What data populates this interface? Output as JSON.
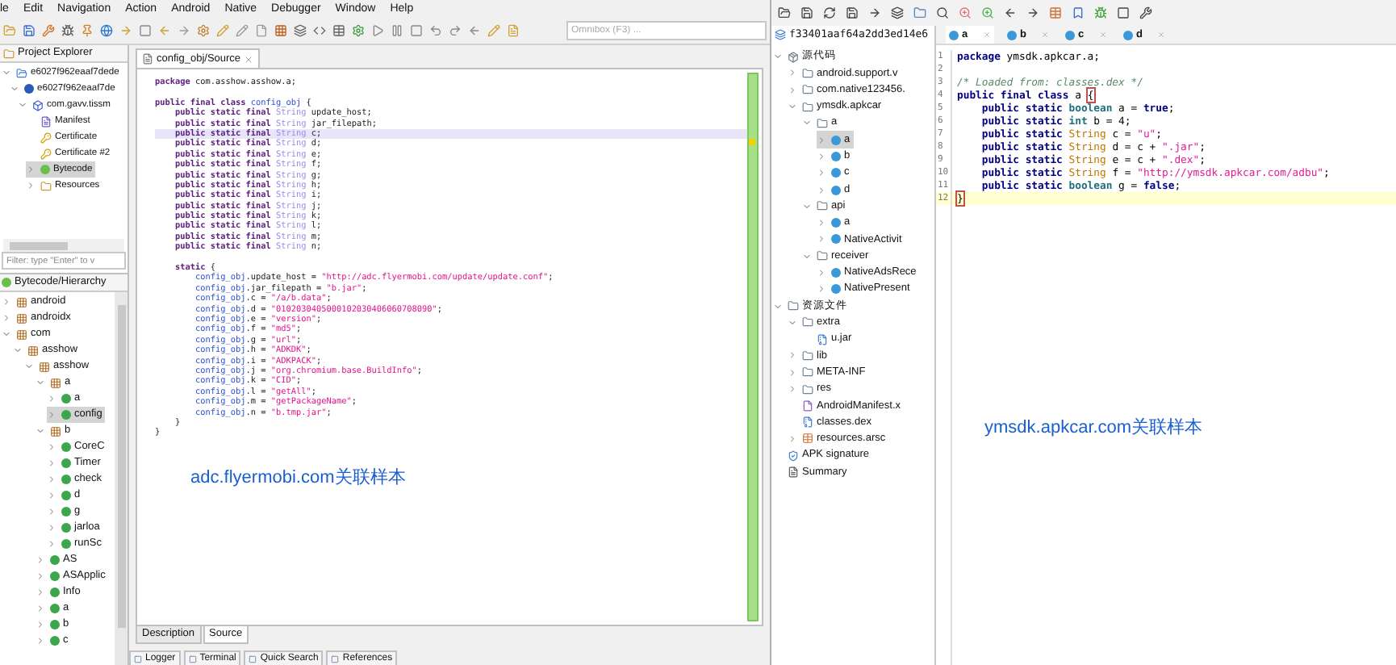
{
  "jeb_window": {
    "menu": [
      "le",
      "Edit",
      "Navigation",
      "Action",
      "Android",
      "Native",
      "Debugger",
      "Window",
      "Help"
    ],
    "omnibox": {
      "placeholder": "Omnibox (F3) ..."
    },
    "project_explorer": {
      "title": "Project Explorer",
      "tree": [
        {
          "label": "e6027f962eaaf7dede",
          "kind": "project",
          "expanded": true,
          "selected": false,
          "children": [
            {
              "label": "e6027f962eaaf7de",
              "kind": "apk",
              "expanded": true,
              "selected": false,
              "children": [
                {
                  "label": "com.gavv.tissm",
                  "kind": "app",
                  "expanded": true,
                  "selected": false,
                  "children": [
                    {
                      "label": "Manifest",
                      "kind": "manifest",
                      "selected": false
                    },
                    {
                      "label": "Certificate",
                      "kind": "cert",
                      "selected": false
                    },
                    {
                      "label": "Certificate #2",
                      "kind": "cert",
                      "selected": false
                    },
                    {
                      "label": "Bytecode",
                      "kind": "bytecode",
                      "expanded": false,
                      "selected": true
                    },
                    {
                      "label": "Resources",
                      "kind": "folder",
                      "expanded": false,
                      "selected": false
                    }
                  ]
                }
              ]
            }
          ]
        }
      ],
      "filter": {
        "placeholder": "Filter: type \"Enter\" to v"
      }
    },
    "hierarchy": {
      "title": "Bytecode/Hierarchy",
      "tree": [
        {
          "label": "android",
          "kind": "package",
          "expanded": false,
          "selected": false
        },
        {
          "label": "androidx",
          "kind": "package",
          "expanded": false,
          "selected": false
        },
        {
          "label": "com",
          "kind": "package",
          "expanded": true,
          "selected": false,
          "children": [
            {
              "label": "asshow",
              "kind": "package",
              "expanded": true,
              "selected": false,
              "children": [
                {
                  "label": "asshow",
                  "kind": "package",
                  "expanded": true,
                  "selected": false,
                  "children": [
                    {
                      "label": "a",
                      "kind": "package",
                      "expanded": true,
                      "selected": false,
                      "children": [
                        {
                          "label": "a",
                          "kind": "class",
                          "expanded": false,
                          "selected": false
                        },
                        {
                          "label": "config",
                          "kind": "class",
                          "expanded": false,
                          "selected": true
                        }
                      ]
                    },
                    {
                      "label": "b",
                      "kind": "package",
                      "expanded": true,
                      "selected": false,
                      "children": [
                        {
                          "label": "CoreC",
                          "kind": "class",
                          "expanded": false,
                          "selected": false
                        },
                        {
                          "label": "Timer",
                          "kind": "class",
                          "expanded": false,
                          "selected": false
                        },
                        {
                          "label": "check",
                          "kind": "class",
                          "expanded": false,
                          "selected": false
                        },
                        {
                          "label": "d",
                          "kind": "class",
                          "expanded": false,
                          "selected": false
                        },
                        {
                          "label": "g",
                          "kind": "class",
                          "expanded": false,
                          "selected": false
                        },
                        {
                          "label": "jarloa",
                          "kind": "class",
                          "expanded": false,
                          "selected": false
                        },
                        {
                          "label": "runSc",
                          "kind": "class",
                          "expanded": false,
                          "selected": false
                        }
                      ]
                    },
                    {
                      "label": "AS",
                      "kind": "class",
                      "expanded": false,
                      "selected": false
                    },
                    {
                      "label": "ASApplic",
                      "kind": "class",
                      "expanded": false,
                      "selected": false
                    },
                    {
                      "label": "Info",
                      "kind": "class",
                      "expanded": false,
                      "selected": false
                    },
                    {
                      "label": "a",
                      "kind": "class",
                      "expanded": false,
                      "selected": false
                    },
                    {
                      "label": "b",
                      "kind": "class",
                      "expanded": false,
                      "selected": false
                    },
                    {
                      "label": "c",
                      "kind": "class",
                      "expanded": false,
                      "selected": false
                    }
                  ]
                }
              ]
            }
          ]
        }
      ]
    },
    "editor": {
      "tab": "config_obj/Source",
      "blocks": [
        [
          {
            "current": false,
            "tokens": [
              {
                "kind": "kw",
                "text": "package"
              },
              {
                "kind": "plain",
                "text": " com.asshow.asshow.a;"
              }
            ]
          }
        ],
        [
          {
            "current": false,
            "tokens": [
              {
                "kind": "kw",
                "text": "public final class "
              },
              {
                "kind": "cls",
                "text": "config_obj"
              },
              {
                "kind": "plain",
                "text": " {"
              }
            ]
          },
          {
            "current": false,
            "tokens": [
              {
                "kind": "kw",
                "text": "    public static final "
              },
              {
                "kind": "type",
                "text": "String"
              },
              {
                "kind": "plain",
                "text": " update_host;"
              }
            ]
          },
          {
            "current": false,
            "tokens": [
              {
                "kind": "kw",
                "text": "    public static final "
              },
              {
                "kind": "type",
                "text": "String"
              },
              {
                "kind": "plain",
                "text": " jar_filepath;"
              }
            ]
          },
          {
            "current": true,
            "tokens": [
              {
                "kind": "kw",
                "text": "    public static final "
              },
              {
                "kind": "type",
                "text": "String"
              },
              {
                "kind": "plain",
                "text": " c;"
              }
            ]
          },
          {
            "current": false,
            "tokens": [
              {
                "kind": "kw",
                "text": "    public static final "
              },
              {
                "kind": "type",
                "text": "String"
              },
              {
                "kind": "plain",
                "text": " d;"
              }
            ]
          },
          {
            "current": false,
            "tokens": [
              {
                "kind": "kw",
                "text": "    public static final "
              },
              {
                "kind": "type",
                "text": "String"
              },
              {
                "kind": "plain",
                "text": " e;"
              }
            ]
          },
          {
            "current": false,
            "tokens": [
              {
                "kind": "kw",
                "text": "    public static final "
              },
              {
                "kind": "type",
                "text": "String"
              },
              {
                "kind": "plain",
                "text": " f;"
              }
            ]
          },
          {
            "current": false,
            "tokens": [
              {
                "kind": "kw",
                "text": "    public static final "
              },
              {
                "kind": "type",
                "text": "String"
              },
              {
                "kind": "plain",
                "text": " g;"
              }
            ]
          },
          {
            "current": false,
            "tokens": [
              {
                "kind": "kw",
                "text": "    public static final "
              },
              {
                "kind": "type",
                "text": "String"
              },
              {
                "kind": "plain",
                "text": " h;"
              }
            ]
          },
          {
            "current": false,
            "tokens": [
              {
                "kind": "kw",
                "text": "    public static final "
              },
              {
                "kind": "type",
                "text": "String"
              },
              {
                "kind": "plain",
                "text": " i;"
              }
            ]
          },
          {
            "current": false,
            "tokens": [
              {
                "kind": "kw",
                "text": "    public static final "
              },
              {
                "kind": "type",
                "text": "String"
              },
              {
                "kind": "plain",
                "text": " j;"
              }
            ]
          },
          {
            "current": false,
            "tokens": [
              {
                "kind": "kw",
                "text": "    public static final "
              },
              {
                "kind": "type",
                "text": "String"
              },
              {
                "kind": "plain",
                "text": " k;"
              }
            ]
          },
          {
            "current": false,
            "tokens": [
              {
                "kind": "kw",
                "text": "    public static final "
              },
              {
                "kind": "type",
                "text": "String"
              },
              {
                "kind": "plain",
                "text": " l;"
              }
            ]
          },
          {
            "current": false,
            "tokens": [
              {
                "kind": "kw",
                "text": "    public static final "
              },
              {
                "kind": "type",
                "text": "String"
              },
              {
                "kind": "plain",
                "text": " m;"
              }
            ]
          },
          {
            "current": false,
            "tokens": [
              {
                "kind": "kw",
                "text": "    public static final "
              },
              {
                "kind": "type",
                "text": "String"
              },
              {
                "kind": "plain",
                "text": " n;"
              }
            ]
          }
        ],
        [
          {
            "current": false,
            "tokens": [
              {
                "kind": "kw",
                "text": "    static"
              },
              {
                "kind": "plain",
                "text": " {"
              }
            ]
          },
          {
            "current": false,
            "tokens": [
              {
                "kind": "cls",
                "text": "        config_obj"
              },
              {
                "kind": "plain",
                "text": ".update_host = "
              },
              {
                "kind": "str",
                "text": "\"http://adc.flyermobi.com/update/update.conf\""
              },
              {
                "kind": "plain",
                "text": ";"
              }
            ]
          },
          {
            "current": false,
            "tokens": [
              {
                "kind": "cls",
                "text": "        config_obj"
              },
              {
                "kind": "plain",
                "text": ".jar_filepath = "
              },
              {
                "kind": "str",
                "text": "\"b.jar\""
              },
              {
                "kind": "plain",
                "text": ";"
              }
            ]
          },
          {
            "current": false,
            "tokens": [
              {
                "kind": "cls",
                "text": "        config_obj"
              },
              {
                "kind": "plain",
                "text": ".c = "
              },
              {
                "kind": "str",
                "text": "\"/a/b.data\""
              },
              {
                "kind": "plain",
                "text": ";"
              }
            ]
          },
          {
            "current": false,
            "tokens": [
              {
                "kind": "cls",
                "text": "        config_obj"
              },
              {
                "kind": "plain",
                "text": ".d = "
              },
              {
                "kind": "str",
                "text": "\"0102030405000102030406060708090\""
              },
              {
                "kind": "plain",
                "text": ";"
              }
            ]
          },
          {
            "current": false,
            "tokens": [
              {
                "kind": "cls",
                "text": "        config_obj"
              },
              {
                "kind": "plain",
                "text": ".e = "
              },
              {
                "kind": "str",
                "text": "\"version\""
              },
              {
                "kind": "plain",
                "text": ";"
              }
            ]
          },
          {
            "current": false,
            "tokens": [
              {
                "kind": "cls",
                "text": "        config_obj"
              },
              {
                "kind": "plain",
                "text": ".f = "
              },
              {
                "kind": "str",
                "text": "\"md5\""
              },
              {
                "kind": "plain",
                "text": ";"
              }
            ]
          },
          {
            "current": false,
            "tokens": [
              {
                "kind": "cls",
                "text": "        config_obj"
              },
              {
                "kind": "plain",
                "text": ".g = "
              },
              {
                "kind": "str",
                "text": "\"url\""
              },
              {
                "kind": "plain",
                "text": ";"
              }
            ]
          },
          {
            "current": false,
            "tokens": [
              {
                "kind": "cls",
                "text": "        config_obj"
              },
              {
                "kind": "plain",
                "text": ".h = "
              },
              {
                "kind": "str",
                "text": "\"ADKDK\""
              },
              {
                "kind": "plain",
                "text": ";"
              }
            ]
          },
          {
            "current": false,
            "tokens": [
              {
                "kind": "cls",
                "text": "        config_obj"
              },
              {
                "kind": "plain",
                "text": ".i = "
              },
              {
                "kind": "str",
                "text": "\"ADKPACK\""
              },
              {
                "kind": "plain",
                "text": ";"
              }
            ]
          },
          {
            "current": false,
            "tokens": [
              {
                "kind": "cls",
                "text": "        config_obj"
              },
              {
                "kind": "plain",
                "text": ".j = "
              },
              {
                "kind": "str",
                "text": "\"org.chromium.base.BuildInfo\""
              },
              {
                "kind": "plain",
                "text": ";"
              }
            ]
          },
          {
            "current": false,
            "tokens": [
              {
                "kind": "cls",
                "text": "        config_obj"
              },
              {
                "kind": "plain",
                "text": ".k = "
              },
              {
                "kind": "str",
                "text": "\"CID\""
              },
              {
                "kind": "plain",
                "text": ";"
              }
            ]
          },
          {
            "current": false,
            "tokens": [
              {
                "kind": "cls",
                "text": "        config_obj"
              },
              {
                "kind": "plain",
                "text": ".l = "
              },
              {
                "kind": "str",
                "text": "\"getAll\""
              },
              {
                "kind": "plain",
                "text": ";"
              }
            ]
          },
          {
            "current": false,
            "tokens": [
              {
                "kind": "cls",
                "text": "        config_obj"
              },
              {
                "kind": "plain",
                "text": ".m = "
              },
              {
                "kind": "str",
                "text": "\"getPackageName\""
              },
              {
                "kind": "plain",
                "text": ";"
              }
            ]
          },
          {
            "current": false,
            "tokens": [
              {
                "kind": "cls",
                "text": "        config_obj"
              },
              {
                "kind": "plain",
                "text": ".n = "
              },
              {
                "kind": "str",
                "text": "\"b.tmp.jar\""
              },
              {
                "kind": "plain",
                "text": ";"
              }
            ]
          },
          {
            "current": false,
            "tokens": [
              {
                "kind": "plain",
                "text": "    }"
              }
            ]
          },
          {
            "current": false,
            "tokens": [
              {
                "kind": "plain",
                "text": "}"
              }
            ]
          }
        ]
      ],
      "view_tabs": [
        {
          "label": "Description",
          "selected": false
        },
        {
          "label": "Source",
          "selected": true
        }
      ]
    },
    "bottom_tabs": [
      "Logger",
      "Terminal",
      "Quick Search",
      "References"
    ],
    "caption": "adc.flyermobi.com关联样本"
  },
  "jadx_window": {
    "tree_root": "f33401aaf64a2dd3ed14e6",
    "tree": [
      {
        "label": "源代码",
        "kind": "sources",
        "expanded": true,
        "selected": false,
        "children": [
          {
            "label": "android.support.v",
            "kind": "package",
            "expanded": false,
            "selected": false
          },
          {
            "label": "com.native123456.",
            "kind": "package",
            "expanded": false,
            "selected": false
          },
          {
            "label": "ymsdk.apkcar",
            "kind": "package",
            "expanded": true,
            "selected": false,
            "children": [
              {
                "label": "a",
                "kind": "package",
                "expanded": true,
                "selected": false,
                "children": [
                  {
                    "label": "a",
                    "kind": "class",
                    "expanded": false,
                    "selected": true
                  },
                  {
                    "label": "b",
                    "kind": "class",
                    "expanded": false,
                    "selected": false
                  },
                  {
                    "label": "c",
                    "kind": "class",
                    "expanded": false,
                    "selected": false
                  },
                  {
                    "label": "d",
                    "kind": "class",
                    "expanded": false,
                    "selected": false
                  }
                ]
              },
              {
                "label": "api",
                "kind": "package",
                "expanded": true,
                "selected": false,
                "children": [
                  {
                    "label": "a",
                    "kind": "class",
                    "expanded": false,
                    "selected": false
                  },
                  {
                    "label": "NativeActivit",
                    "kind": "class",
                    "expanded": false,
                    "selected": false
                  }
                ]
              },
              {
                "label": "receiver",
                "kind": "package",
                "expanded": true,
                "selected": false,
                "children": [
                  {
                    "label": "NativeAdsRece",
                    "kind": "class",
                    "expanded": false,
                    "selected": false
                  },
                  {
                    "label": "NativePresent",
                    "kind": "class",
                    "expanded": false,
                    "selected": false
                  }
                ]
              }
            ]
          }
        ]
      },
      {
        "label": "资源文件",
        "kind": "resources",
        "expanded": true,
        "selected": false,
        "children": [
          {
            "label": "extra",
            "kind": "folder",
            "expanded": true,
            "selected": false,
            "children": [
              {
                "label": "u.jar",
                "kind": "file",
                "selected": false
              }
            ]
          },
          {
            "label": "lib",
            "kind": "folder",
            "expanded": false,
            "selected": false
          },
          {
            "label": "META-INF",
            "kind": "folder",
            "expanded": false,
            "selected": false
          },
          {
            "label": "res",
            "kind": "folder",
            "expanded": false,
            "selected": false
          },
          {
            "label": "AndroidManifest.x",
            "kind": "manifest",
            "selected": false
          },
          {
            "label": "classes.dex",
            "kind": "file",
            "selected": false
          },
          {
            "label": "resources.arsc",
            "kind": "arsc",
            "expanded": false,
            "selected": false
          }
        ]
      },
      {
        "label": "APK signature",
        "kind": "signature",
        "selected": false
      },
      {
        "label": "Summary",
        "kind": "summary",
        "selected": false
      }
    ],
    "tabs": [
      {
        "label": "a",
        "selected": true
      },
      {
        "label": "b",
        "selected": false
      },
      {
        "label": "c",
        "selected": false
      },
      {
        "label": "d",
        "selected": false
      }
    ],
    "lines": [
      {
        "num": "1",
        "current": false,
        "tokens": [
          {
            "kind": "kw",
            "text": "package"
          },
          {
            "kind": "plain",
            "text": " ymsdk.apkcar.a;"
          }
        ]
      },
      {
        "num": "2"
      },
      {
        "num": "3",
        "current": false,
        "tokens": [
          {
            "kind": "comment",
            "text": "/* Loaded from: classes.dex */"
          }
        ]
      },
      {
        "num": "4",
        "current": false,
        "tokens": [
          {
            "kind": "kw",
            "text": "public final class"
          },
          {
            "kind": "plain",
            "text": " a "
          },
          {
            "kind": "match",
            "text": "{"
          }
        ]
      },
      {
        "num": "5",
        "current": false,
        "tokens": [
          {
            "kind": "kw",
            "text": "    public static "
          },
          {
            "kind": "prim",
            "text": "boolean"
          },
          {
            "kind": "plain",
            "text": " a = "
          },
          {
            "kind": "kw",
            "text": "true"
          },
          {
            "kind": "plain",
            "text": ";"
          }
        ]
      },
      {
        "num": "6",
        "current": false,
        "tokens": [
          {
            "kind": "kw",
            "text": "    public static "
          },
          {
            "kind": "prim",
            "text": "int"
          },
          {
            "kind": "plain",
            "text": " b = 4;"
          }
        ]
      },
      {
        "num": "7",
        "current": false,
        "tokens": [
          {
            "kind": "kw",
            "text": "    public static "
          },
          {
            "kind": "type",
            "text": "String"
          },
          {
            "kind": "plain",
            "text": " c = "
          },
          {
            "kind": "str",
            "text": "\"u\""
          },
          {
            "kind": "plain",
            "text": ";"
          }
        ]
      },
      {
        "num": "8",
        "current": false,
        "tokens": [
          {
            "kind": "kw",
            "text": "    public static "
          },
          {
            "kind": "type",
            "text": "String"
          },
          {
            "kind": "plain",
            "text": " d = c + "
          },
          {
            "kind": "str",
            "text": "\".jar\""
          },
          {
            "kind": "plain",
            "text": ";"
          }
        ]
      },
      {
        "num": "9",
        "current": false,
        "tokens": [
          {
            "kind": "kw",
            "text": "    public static "
          },
          {
            "kind": "type",
            "text": "String"
          },
          {
            "kind": "plain",
            "text": " e = c + "
          },
          {
            "kind": "str",
            "text": "\".dex\""
          },
          {
            "kind": "plain",
            "text": ";"
          }
        ]
      },
      {
        "num": "10",
        "current": false,
        "tokens": [
          {
            "kind": "kw",
            "text": "    public static "
          },
          {
            "kind": "type",
            "text": "String"
          },
          {
            "kind": "plain",
            "text": " f = "
          },
          {
            "kind": "str",
            "text": "\"http://ymsdk.apkcar.com/adbu\""
          },
          {
            "kind": "plain",
            "text": ";"
          }
        ]
      },
      {
        "num": "11",
        "current": false,
        "tokens": [
          {
            "kind": "kw",
            "text": "    public static "
          },
          {
            "kind": "prim",
            "text": "boolean"
          },
          {
            "kind": "plain",
            "text": " g = "
          },
          {
            "kind": "kw",
            "text": "false"
          },
          {
            "kind": "plain",
            "text": ";"
          }
        ]
      },
      {
        "num": "12",
        "current": true,
        "tokens": [
          {
            "kind": "match",
            "text": "}"
          }
        ]
      }
    ],
    "caption": "ymsdk.apkcar.com关联样本"
  }
}
